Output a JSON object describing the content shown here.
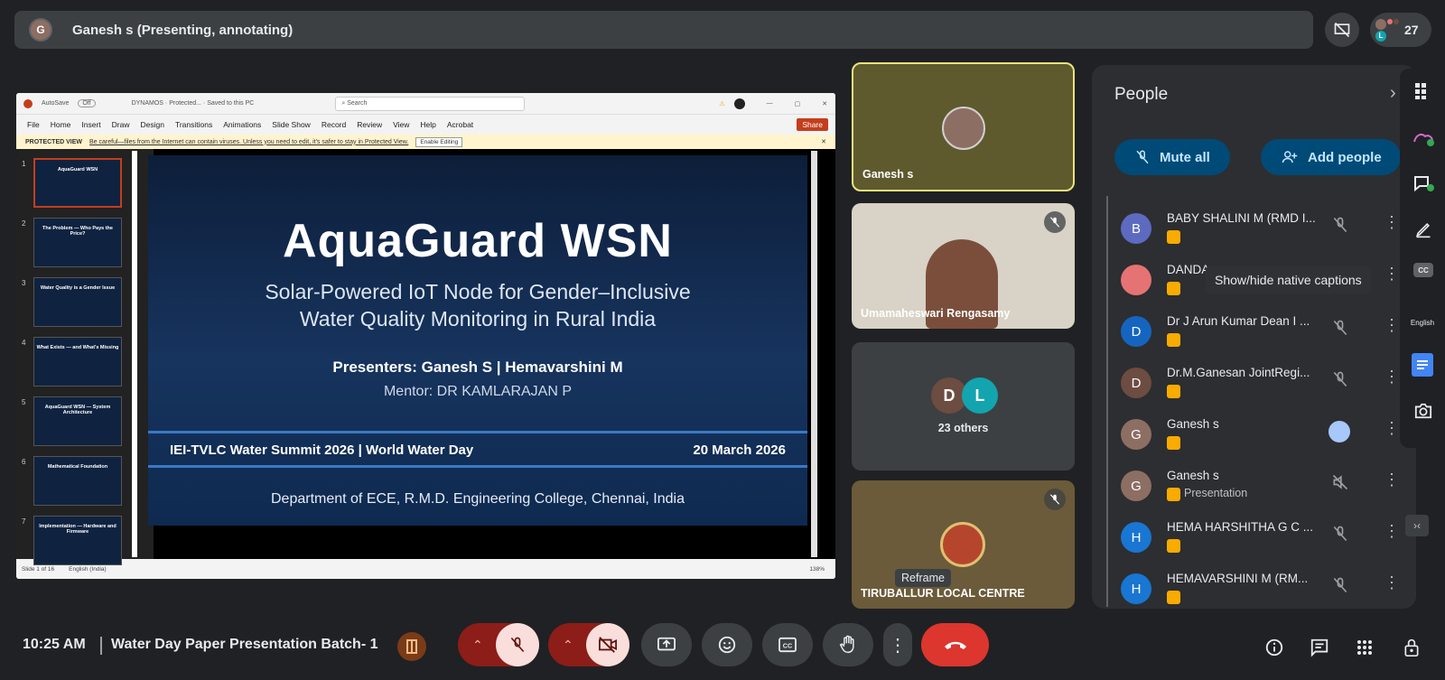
{
  "top_bar": {
    "presenter_label": "Ganesh s (Presenting, annotating)",
    "avatar_initial": "G",
    "participant_count": "27",
    "count_avatar_letter": "L"
  },
  "presentation": {
    "app_title": "DYNAMOS · Protected... · Saved to this PC",
    "autosave_label": "AutoSave",
    "autosave_state": "Off",
    "search_placeholder": "Search",
    "menu": [
      "File",
      "Home",
      "Insert",
      "Draw",
      "Design",
      "Transitions",
      "Animations",
      "Slide Show",
      "Record",
      "Review",
      "View",
      "Help",
      "Acrobat"
    ],
    "share_label": "Share",
    "protected_label": "PROTECTED VIEW",
    "protected_text": "Be careful—files from the Internet can contain viruses. Unless you need to edit, it's safer to stay in Protected View.",
    "enable_editing": "Enable Editing",
    "thumbnails": [
      {
        "num": "1",
        "title": "AquaGuard WSN"
      },
      {
        "num": "2",
        "title": "The Problem — Who Pays the Price?"
      },
      {
        "num": "3",
        "title": "Water Quality is a Gender Issue"
      },
      {
        "num": "4",
        "title": "What Exists — and What's Missing"
      },
      {
        "num": "5",
        "title": "AquaGuard WSN — System Architecture"
      },
      {
        "num": "6",
        "title": "Mathematical Foundation"
      },
      {
        "num": "7",
        "title": "Implementation — Hardware and Firmware"
      }
    ],
    "slide": {
      "title": "AquaGuard WSN",
      "subtitle_line1": "Solar-Powered IoT Node for Gender–Inclusive",
      "subtitle_line2": "Water Quality Monitoring in Rural India",
      "presenters": "Presenters: Ganesh S | Hemavarshini M",
      "mentor": "Mentor: DR KAMLARAJAN P",
      "event": "IEI-TVLC Water Summit 2026 | World Water Day",
      "date": "20 March 2026",
      "department": "Department of ECE, R.M.D. Engineering College, Chennai, India"
    },
    "status_slide": "Slide 1 of 16",
    "status_lang": "English (India)",
    "status_zoom": "138%"
  },
  "tiles": [
    {
      "name": "Ganesh s"
    },
    {
      "name": "Umamaheswari Rengasamy"
    },
    {
      "name": "23 others",
      "av1": "D",
      "av2": "L"
    },
    {
      "name": "TIRUBALLUR LOCAL CENTRE",
      "hover_label": "Reframe"
    }
  ],
  "people_panel": {
    "title": "People",
    "mute_all": "Mute all",
    "add_people": "Add people",
    "participants": [
      {
        "initial": "B",
        "name": "BABY SHALINI M (RMD I...",
        "subtitle": "",
        "color": "#5c6bc0"
      },
      {
        "initial": "",
        "name": "DANDA",
        "subtitle": "",
        "color": "#e57373"
      },
      {
        "initial": "D",
        "name": "Dr J Arun Kumar Dean I ...",
        "subtitle": "",
        "color": "#1565c0"
      },
      {
        "initial": "D",
        "name": "Dr.M.Ganesan JointRegi...",
        "subtitle": "",
        "color": "#6d4c41"
      },
      {
        "initial": "G",
        "name": "Ganesh s",
        "subtitle": "",
        "color": "#8d6e63"
      },
      {
        "initial": "G",
        "name": "Ganesh s",
        "subtitle": "Presentation",
        "color": "#8d6e63"
      },
      {
        "initial": "H",
        "name": "HEMA HARSHITHA G C ...",
        "subtitle": "",
        "color": "#1976d2"
      },
      {
        "initial": "H",
        "name": "HEMAVARSHINI M (RM...",
        "subtitle": "",
        "color": "#1976d2"
      }
    ],
    "tooltip": "Show/hide native captions"
  },
  "sidebar": {
    "cc_label": "CC",
    "lang_label": "English"
  },
  "bottom_bar": {
    "time": "10:25 AM",
    "meeting_title": "Water Day Paper Presentation Batch- 1"
  },
  "colors": {
    "background": "#202124",
    "danger": "#ea4335",
    "muted_control": "#f9dedc",
    "accent": "#8ab4f8"
  }
}
